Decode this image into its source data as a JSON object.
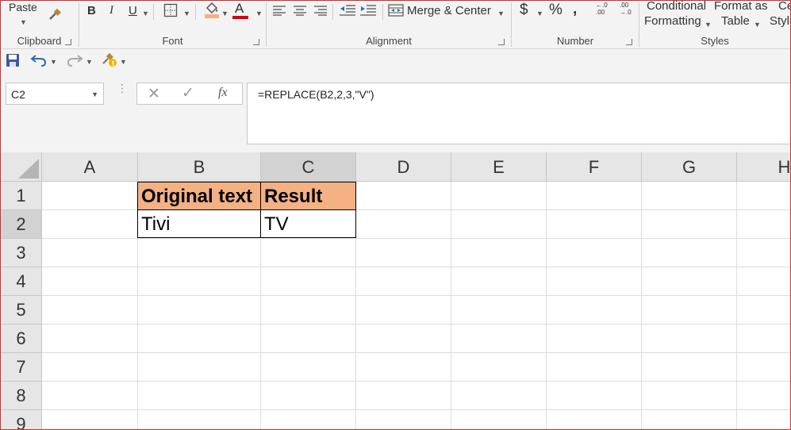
{
  "ribbon": {
    "clipboard": {
      "paste_label": "Paste",
      "group_label": "Clipboard"
    },
    "font": {
      "bold": "B",
      "italic": "I",
      "underline": "U",
      "font_color_letter": "A",
      "group_label": "Font"
    },
    "alignment": {
      "merge_center_label": "Merge & Center",
      "group_label": "Alignment"
    },
    "number": {
      "currency": "$",
      "percent": "%",
      "comma": ",",
      "inc_decimal": "←.0 .00",
      "dec_decimal": ".00 →.0",
      "group_label": "Number"
    },
    "styles": {
      "conditional_line1": "Conditional",
      "conditional_line2": "Formatting",
      "format_as_line1": "Format as",
      "format_as_line2": "Table",
      "cell_styles_line1": "Ce",
      "cell_styles_line2": "Style",
      "group_label": "Styles"
    }
  },
  "formula_bar": {
    "name_box": "C2",
    "fx_label": "fx",
    "formula": "=REPLACE(B2,2,3,\"V\")"
  },
  "sheet": {
    "columns": [
      "A",
      "B",
      "C",
      "D",
      "E",
      "F",
      "G",
      "H"
    ],
    "rows": [
      "1",
      "2",
      "3",
      "4",
      "5",
      "6",
      "7",
      "8",
      "9"
    ],
    "cells": {
      "B1": "Original text",
      "C1": "Result",
      "B2": "Tivi",
      "C2": "TV"
    }
  },
  "colors": {
    "header_fill": "#f4b183",
    "font_color_bar": "#e00000",
    "fill_color_bar": "#f4b183",
    "frame_border": "#d12f2f"
  }
}
